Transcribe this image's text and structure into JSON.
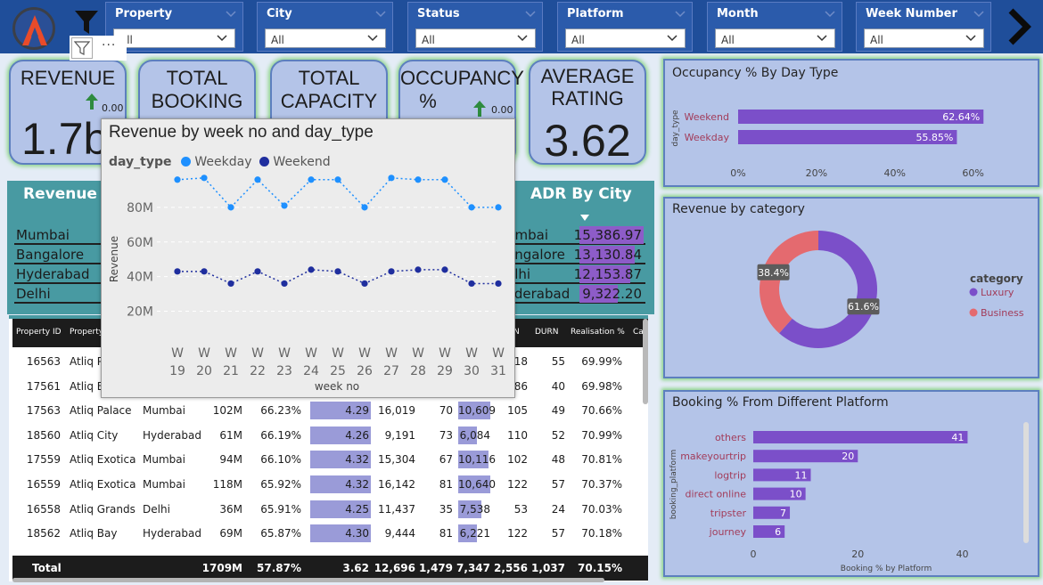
{
  "filters": [
    {
      "label": "Property",
      "value": "All"
    },
    {
      "label": "City",
      "value": "All"
    },
    {
      "label": "Status",
      "value": "All"
    },
    {
      "label": "Platform",
      "value": "All"
    },
    {
      "label": "Month",
      "value": "All"
    },
    {
      "label": "Week Number",
      "value": "All"
    }
  ],
  "kpis": {
    "revenue": {
      "title": "REVENUE",
      "value": "1.7bn",
      "delta": "0.00"
    },
    "total_booking": {
      "title_line1": "TOTAL",
      "title_line2": "BOOKING"
    },
    "total_capacity": {
      "title_line1": "TOTAL",
      "title_line2": "CAPACITY"
    },
    "occupancy": {
      "title_line1": "OCCUPANCY",
      "title_line2": "%",
      "delta": "0.00"
    },
    "average_rating": {
      "title_line1": "AVERAGE",
      "title_line2": "RATING",
      "value": "3.62"
    }
  },
  "revenue_by_city": {
    "title": "Revenue by",
    "rows": [
      {
        "city": "Mumbai",
        "bar": 0.78
      },
      {
        "city": "Bangalore",
        "bar": 0.62
      },
      {
        "city": "Hyderabad",
        "bar": 0.45
      },
      {
        "city": "Delhi",
        "bar": 0.3
      }
    ]
  },
  "adr_by_city": {
    "title": "ADR By City",
    "rows": [
      {
        "city": "umbai",
        "value": "15,386.97",
        "bar": 1.0
      },
      {
        "city": "angalore",
        "value": "13,130.84",
        "bar": 0.86
      },
      {
        "city": "elhi",
        "value": "12,153.87",
        "bar": 0.79
      },
      {
        "city": "yderabad",
        "value": "9,322.20",
        "bar": 0.6
      }
    ]
  },
  "table": {
    "headers": [
      "Property ID",
      "Property",
      "DURN",
      "Realisation %",
      "Ca"
    ],
    "headers_extra": [
      "N"
    ],
    "rows": [
      {
        "id": "16563",
        "name": "Atliq P",
        "city": "",
        "rev": "",
        "occ": "",
        "rating": "",
        "a": "",
        "b": "",
        "c": "",
        "d": "18",
        "durn": "55",
        "real": "69.99%"
      },
      {
        "id": "17561",
        "name": "Atliq B",
        "city": "",
        "rev": "",
        "occ": "",
        "rating": "",
        "a": "",
        "b": "",
        "c": "",
        "d": "86",
        "durn": "40",
        "real": "69.98%"
      },
      {
        "id": "17563",
        "name": "Atliq Palace",
        "city": "Mumbai",
        "rev": "102M",
        "occ": "66.23%",
        "rating": "4.29",
        "a": "16,019",
        "b": "70",
        "c": "10,609",
        "d": "105",
        "durn": "49",
        "real": "70.66%"
      },
      {
        "id": "18560",
        "name": "Atliq City",
        "city": "Hyderabad",
        "rev": "61M",
        "occ": "66.19%",
        "rating": "4.26",
        "a": "9,191",
        "b": "73",
        "c": "6,084",
        "d": "110",
        "durn": "52",
        "real": "70.99%"
      },
      {
        "id": "17559",
        "name": "Atliq Exotica",
        "city": "Mumbai",
        "rev": "94M",
        "occ": "66.10%",
        "rating": "4.32",
        "a": "15,304",
        "b": "67",
        "c": "10,116",
        "d": "102",
        "durn": "48",
        "real": "70.81%"
      },
      {
        "id": "16559",
        "name": "Atliq Exotica",
        "city": "Mumbai",
        "rev": "118M",
        "occ": "65.92%",
        "rating": "4.32",
        "a": "16,142",
        "b": "81",
        "c": "10,640",
        "d": "122",
        "durn": "57",
        "real": "70.37%"
      },
      {
        "id": "16558",
        "name": "Atliq Grands",
        "city": "Delhi",
        "rev": "36M",
        "occ": "65.91%",
        "rating": "4.25",
        "a": "11,437",
        "b": "35",
        "c": "7,538",
        "d": "53",
        "durn": "24",
        "real": "70.03%"
      },
      {
        "id": "18562",
        "name": "Atliq Bay",
        "city": "Hyderabad",
        "rev": "69M",
        "occ": "65.87%",
        "rating": "4.30",
        "a": "9,444",
        "b": "81",
        "c": "6,221",
        "d": "122",
        "durn": "57",
        "real": "70.18%"
      }
    ],
    "total": {
      "label": "Total",
      "rev": "1709M",
      "occ": "57.87%",
      "rating": "3.62",
      "a": "12,696",
      "b": "1,479",
      "c": "7,347",
      "d": "2,556",
      "durn": "1,037",
      "real": "70.15%"
    }
  },
  "chart_data": [
    {
      "type": "line",
      "title": "Revenue by week no and day_type",
      "legend_title": "day_type",
      "xlabel": "week no",
      "ylabel": "Revenue",
      "x": [
        "W 19",
        "W 20",
        "W 21",
        "W 22",
        "W 23",
        "W 24",
        "W 25",
        "W 26",
        "W 27",
        "W 28",
        "W 29",
        "W 30",
        "W 31"
      ],
      "yticks": [
        "20M",
        "40M",
        "60M",
        "80M"
      ],
      "ylim": [
        10,
        100
      ],
      "series": [
        {
          "name": "Weekday",
          "color": "#1e90ff",
          "values": [
            96,
            97,
            80,
            96,
            81,
            96,
            96,
            80,
            97,
            96,
            96,
            80,
            80
          ]
        },
        {
          "name": "Weekend",
          "color": "#1f2e9e",
          "values": [
            43,
            43,
            36,
            43,
            36,
            44,
            43,
            36,
            43,
            44,
            44,
            36,
            36
          ]
        }
      ]
    },
    {
      "type": "bar",
      "title": "Occupancy % By Day Type",
      "ylabel": "day_type",
      "categories": [
        "Weekend",
        "Weekday"
      ],
      "values": [
        62.64,
        55.85
      ],
      "value_labels": [
        "62.64%",
        "55.85%"
      ],
      "xticks": [
        "0%",
        "20%",
        "40%",
        "60%"
      ],
      "xlim": [
        0,
        66
      ]
    },
    {
      "type": "pie",
      "title": "Revenue by category",
      "legend_title": "category",
      "categories": [
        "Luxury",
        "Business"
      ],
      "values": [
        61.6,
        38.4
      ],
      "value_labels": [
        "61.6%",
        "38.4%"
      ],
      "colors": [
        "#7b4fc9",
        "#e46a6f"
      ]
    },
    {
      "type": "bar",
      "title": "Booking % From Different Platform",
      "xlabel": "Booking % by Platform",
      "ylabel": "booking_platform",
      "categories": [
        "others",
        "makeyourtrip",
        "logtrip",
        "direct online",
        "tripster",
        "journey"
      ],
      "values": [
        41,
        20,
        11,
        10,
        7,
        6
      ],
      "xticks": [
        "0",
        "20",
        "40"
      ],
      "xlim": [
        0,
        44
      ]
    }
  ]
}
